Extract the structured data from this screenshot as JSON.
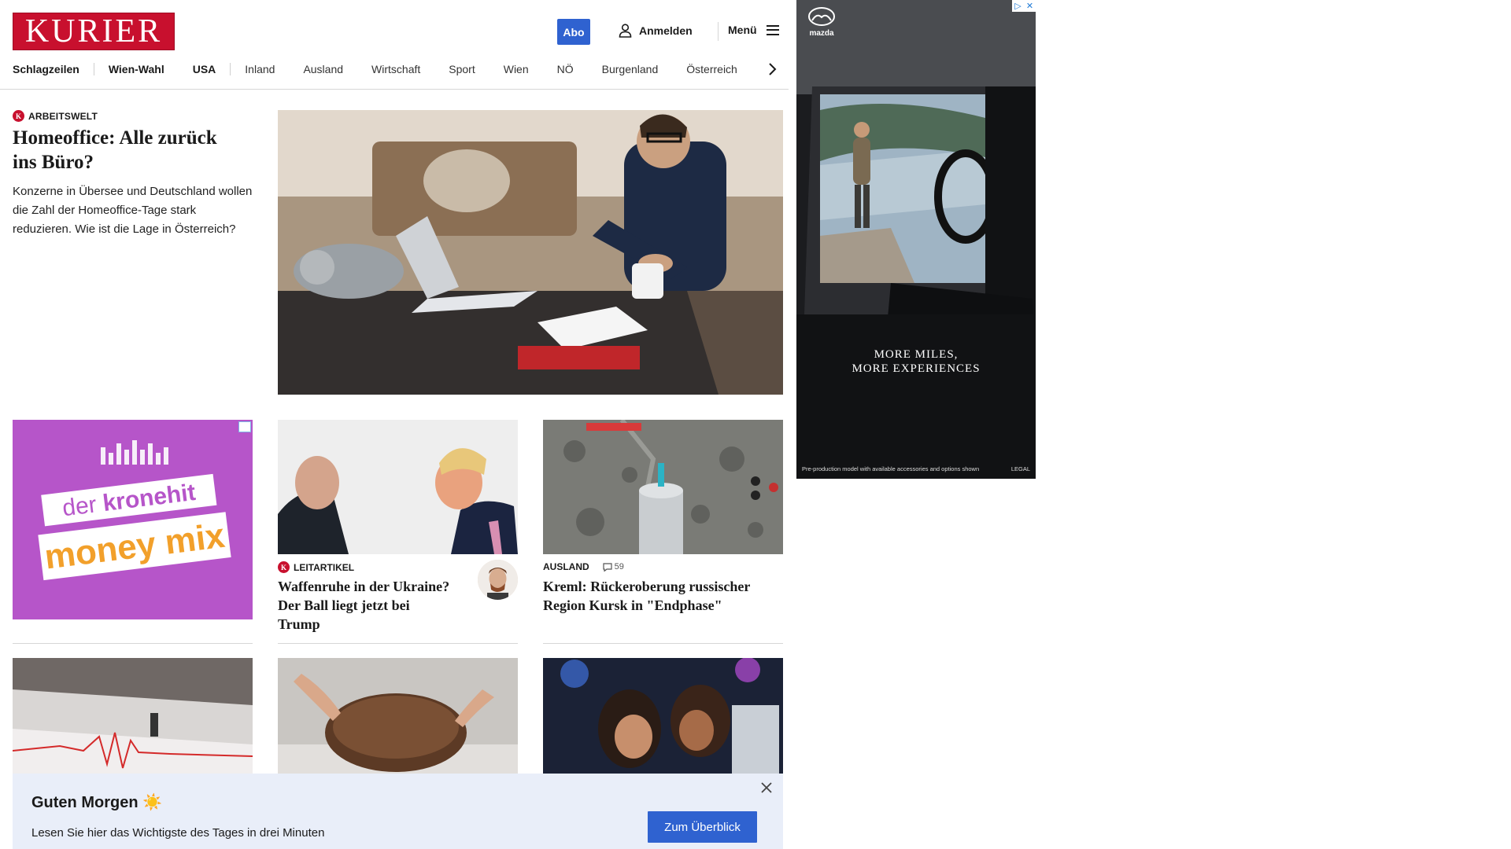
{
  "header": {
    "logo_text": "KURIER",
    "abo_label": "Abo",
    "login_label": "Anmelden",
    "menu_label": "Menü",
    "brand_color": "#c8102e",
    "accent_color": "#2f62d0"
  },
  "nav": {
    "items": [
      "Schlagzeilen",
      "Wien-Wahl",
      "USA",
      "Inland",
      "Ausland",
      "Wirtschaft",
      "Sport",
      "Wien",
      "NÖ",
      "Burgenland",
      "Österreich"
    ]
  },
  "lead": {
    "kicker": "ARBEITSWELT",
    "title": "Homeoffice: Alle zurück ins Büro?",
    "teaser": "Konzerne in Übersee und Deutschland wollen die Zahl der Homeoffice-Tage stark reduzieren. Wie ist die Lage in Österreich?"
  },
  "kronehit_ad": {
    "line1": "der",
    "line1b": "kronehit",
    "line2": "money mix"
  },
  "cards": [
    {
      "kicker": "LEITARTIKEL",
      "title": "Waffenruhe in der Ukraine? Der Ball liegt jetzt bei Trump"
    },
    {
      "kicker": "AUSLAND",
      "comments": "59",
      "title": "Kreml: Rückeroberung russischer Region Kursk in \"Endphase\""
    }
  ],
  "mazda_ad": {
    "brand": "mazda",
    "tagline_1": "MORE MILES,",
    "tagline_2": "MORE EXPERIENCES",
    "disclaimer": "Pre-production model with available accessories and options shown",
    "legal": "LEGAL"
  },
  "banner": {
    "title": "Guten Morgen ☀️",
    "text": "Lesen Sie hier das Wichtigste des Tages in drei Minuten",
    "button": "Zum Überblick"
  }
}
